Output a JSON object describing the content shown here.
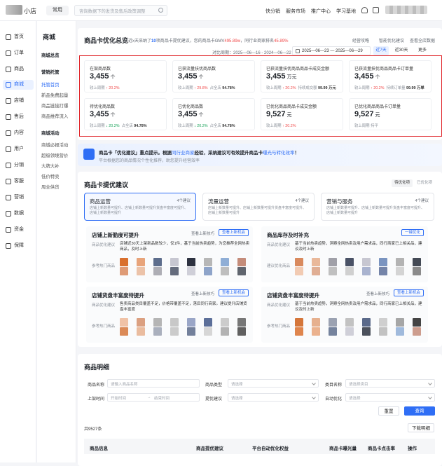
{
  "topbar": {
    "shop_name": "小店",
    "common_label": "常用",
    "search_placeholder": "咨询数据下的发货及售后政策调整",
    "nav": [
      "快分销",
      "服务市场",
      "推广中心",
      "学习基地"
    ]
  },
  "sidebar": {
    "items": [
      {
        "label": "首页",
        "icon": "home-icon"
      },
      {
        "label": "订单",
        "icon": "order-icon"
      },
      {
        "label": "商品",
        "icon": "goods-icon"
      },
      {
        "label": "商城",
        "icon": "mall-icon",
        "active": true
      },
      {
        "label": "店铺",
        "icon": "store-icon"
      },
      {
        "label": "售后",
        "icon": "after-sale-icon"
      },
      {
        "label": "内容",
        "icon": "content-icon"
      },
      {
        "label": "用户",
        "icon": "user-icon"
      },
      {
        "label": "分销",
        "icon": "share-icon"
      },
      {
        "label": "客服",
        "icon": "service-icon"
      },
      {
        "label": "营销",
        "icon": "marketing-icon"
      },
      {
        "label": "数据",
        "icon": "data-icon"
      },
      {
        "label": "资金",
        "icon": "fund-icon"
      },
      {
        "label": "保障",
        "icon": "shield-icon"
      }
    ]
  },
  "subnav": {
    "title": "商城",
    "overview": "商城总览",
    "group1": "营销托管",
    "group1_items": [
      "托管首页",
      "新品免费起量",
      "商品链接打爆",
      "商品推荐流入"
    ],
    "group2": "商城活动",
    "group2_items": [
      "商城必报活动",
      "超级领境营价",
      "大牌大补",
      "低价特卖",
      "周全供货"
    ]
  },
  "overview": {
    "title": "商品卡优化总览",
    "desc_prefix": "近x天采纳了",
    "desc_count": "10",
    "desc_mid": "项商品卡提优建议，您的商品卡GMV",
    "desc_gmv": "495.89w",
    "desc_rank_prefix": "，同行业商家排名",
    "desc_rank": "45.89%",
    "links": [
      "经营攻略",
      "智能优化建议",
      "查看全店数据"
    ],
    "compare_label": "对比周期：2025—06—16 - 2024—06—22",
    "date_range": "2025—06—23 — 2025—06—29",
    "range_tabs": [
      "近7天",
      "近30天",
      "更多"
    ],
    "metrics": [
      {
        "title": "在架商品数",
        "value": "3,455",
        "unit": "个",
        "sub": "较上周期",
        "change": "20.2%",
        "dir": "up",
        "extra_label": "",
        "extra_value": ""
      },
      {
        "title": "已获流量扶优商品数",
        "value": "3,455",
        "unit": "个",
        "sub": "较上周期",
        "change": "29.8%",
        "dir": "up",
        "extra_label": "占全店",
        "extra_value": "94.78%"
      },
      {
        "title": "已获流量扶优商品商品卡成交金额",
        "value": "3,455",
        "unit": "万元",
        "sub": "较上周期",
        "change": "20.2%",
        "dir": "up",
        "extra_label": "持续成交额",
        "extra_value": "99.99 万元"
      },
      {
        "title": "已获流量扶优商品商品卡订单量",
        "value": "3,455",
        "unit": "个",
        "sub": "较上周期",
        "change": "20.2%",
        "dir": "up",
        "extra_label": "持续订单量",
        "extra_value": "99.99 万单"
      },
      {
        "title": "待优化商品数",
        "value": "3,455",
        "unit": "个",
        "sub": "较上周期",
        "change": "20.2%",
        "dir": "dn",
        "extra_label": "占全店",
        "extra_value": "94.78%"
      },
      {
        "title": "已优化商品数",
        "value": "3,455",
        "unit": "个",
        "sub": "较上周期",
        "change": "20.2%",
        "dir": "dn",
        "extra_label": "占全店",
        "extra_value": "94.78%"
      },
      {
        "title": "已优化商品商品卡成交金额",
        "value": "9,527",
        "unit": "元",
        "sub": "较上周期",
        "change": "20.2%",
        "dir": "up",
        "extra_label": "",
        "extra_value": ""
      },
      {
        "title": "已优化商品商品卡订单量",
        "value": "9,527",
        "unit": "元",
        "sub": "较上周期",
        "change": "持平",
        "dir": "flat",
        "extra_label": "",
        "extra_value": ""
      }
    ]
  },
  "banner": {
    "prefix": "商品卡「优化建议」重点提示。根据",
    "highlight1": "同行业商家",
    "mid": "经验，采纳建议可有效提升商品卡",
    "highlight2": "曝光与转化效率",
    "suffix": "！",
    "sub": "平台根据您的商品情况个性化推荐，助您提升经营效率"
  },
  "suggest": {
    "title": "商品卡提优建议",
    "filter_tabs": [
      "待优化项",
      "已优化项"
    ],
    "tabs": [
      {
        "title": "商品运营",
        "count": "4个建议",
        "desc": "店铺上新数量可提升、店铺上新数量可提升货盘丰富度可提升、店铺上新数量可提升"
      },
      {
        "title": "流量运营",
        "count": "4个建议",
        "desc": "店铺上新数量可提升、店铺上新数量可提升货盘丰富度可提升、店铺上新数量可提升"
      },
      {
        "title": "营销与服务",
        "count": "4个建议",
        "desc": "店铺上新数量可提升、店铺上新数量可提升货盘丰富度可提升、店铺上新数量可提升"
      }
    ],
    "cards": [
      {
        "title": "店铺上新勤度可提升",
        "label": "商品优化建议",
        "desc": "店铺近30天上架新品数较少，仅1件，基于当前热卖趋势，为您推荐全网热卖商品，及时上新",
        "ref": "参考热门商品",
        "link": "查看上新技巧",
        "btn": "查看上新机会"
      },
      {
        "title": "商品库存及时补充",
        "label": "商品优化建议",
        "desc": "基于当前热卖趋势，洞察全网热卖及用户需求品，同行商家已上相关品，建议及时上新",
        "ref": "建议优化商品",
        "link": "",
        "btn": "一键优化"
      },
      {
        "title": "店铺货盘丰富度待提升",
        "label": "商品优化建议",
        "desc": "售卖商品类目覆盖不足，价格带覆盖不足，落后同行商家。建议提升店铺货盘丰富度",
        "ref": "参考热门商品",
        "link": "查看上新技巧",
        "btn": "查看上新机会"
      },
      {
        "title": "店铺货盘丰富度待提升",
        "label": "商品优化建议",
        "desc": "基于当前热卖趋势，洞察全网热卖及用户需求品，同行商家已上相关品，建议及时上新",
        "ref": "参考热门商品",
        "link": "查看上新技巧",
        "btn": "查看上新机会"
      }
    ]
  },
  "detail": {
    "title": "商品明细",
    "fields": [
      {
        "label": "商品名称",
        "placeholder": "请输入商品名称"
      },
      {
        "label": "商品类型",
        "placeholder": "请选择"
      },
      {
        "label": "类目名称",
        "placeholder": "请选择类目"
      },
      {
        "label": "上架时间",
        "placeholder": "开始时间"
      },
      {
        "label": "提优建议",
        "placeholder": "请选择"
      },
      {
        "label": "自动优化",
        "placeholder": "请选择"
      }
    ],
    "date_sep": "→",
    "date_end": "结束时间",
    "reset": "重置",
    "query": "查询",
    "total": "共9527条",
    "download": "下载明细",
    "columns": [
      "商品信息",
      "商品提优建议",
      "平台自动优化权益",
      "商品卡曝光量",
      "商品卡点击率",
      "操作"
    ]
  }
}
